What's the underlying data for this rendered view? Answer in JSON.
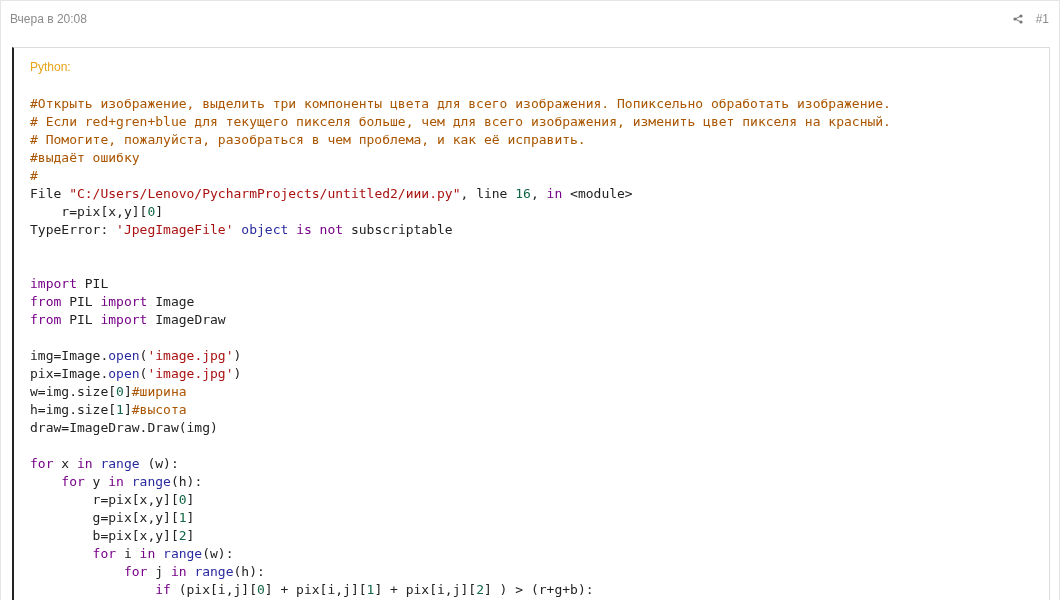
{
  "post": {
    "time": "Вчера в 20:08",
    "number": "#1"
  },
  "code_block": {
    "language": "Python:",
    "lines": [
      {
        "kind": "code",
        "tokens": [
          {
            "kind": "comment",
            "text": "#Открыть изображение, выделить три компоненты цвета для всего изображения. Попиксельно обработать изображение."
          }
        ]
      },
      {
        "kind": "code",
        "tokens": [
          {
            "kind": "comment",
            "text": "# Если red+gren+blue для текущего пикселя больше, чем для всего изображения, изменить цвет пикселя на красный."
          }
        ]
      },
      {
        "kind": "code",
        "tokens": [
          {
            "kind": "comment",
            "text": "# Помогите, пожалуйста, разобраться в чем проблема, и как её исправить."
          }
        ]
      },
      {
        "kind": "code",
        "tokens": [
          {
            "kind": "comment",
            "text": "#выдаёт ошибку"
          }
        ]
      },
      {
        "kind": "code",
        "tokens": [
          {
            "kind": "comment",
            "text": "#"
          }
        ]
      },
      {
        "kind": "code",
        "tokens": [
          {
            "kind": "plain",
            "text": "File "
          },
          {
            "kind": "string",
            "text": "\"C:/Users/Lenovo/PycharmProjects/untitled2/иии.py\""
          },
          {
            "kind": "plain",
            "text": ", line "
          },
          {
            "kind": "number",
            "text": "16"
          },
          {
            "kind": "plain",
            "text": ", "
          },
          {
            "kind": "keyword",
            "text": "in"
          },
          {
            "kind": "plain",
            "text": " <module>"
          }
        ]
      },
      {
        "kind": "code",
        "tokens": [
          {
            "kind": "plain",
            "text": "    r=pix[x,y]["
          },
          {
            "kind": "number",
            "text": "0"
          },
          {
            "kind": "plain",
            "text": "]"
          }
        ]
      },
      {
        "kind": "code",
        "tokens": [
          {
            "kind": "plain",
            "text": "TypeError: "
          },
          {
            "kind": "string",
            "text": "'JpegImageFile' "
          },
          {
            "kind": "builtin",
            "text": "object "
          },
          {
            "kind": "keyword",
            "text": "is "
          },
          {
            "kind": "keyword",
            "text": "not"
          },
          {
            "kind": "plain",
            "text": " subscriptable"
          }
        ]
      },
      {
        "kind": "blank"
      },
      {
        "kind": "blank"
      },
      {
        "kind": "code",
        "tokens": [
          {
            "kind": "keyword",
            "text": "import"
          },
          {
            "kind": "plain",
            "text": " PIL"
          }
        ]
      },
      {
        "kind": "code",
        "tokens": [
          {
            "kind": "keyword",
            "text": "from"
          },
          {
            "kind": "plain",
            "text": " PIL "
          },
          {
            "kind": "keyword",
            "text": "import"
          },
          {
            "kind": "plain",
            "text": " Image"
          }
        ]
      },
      {
        "kind": "code",
        "tokens": [
          {
            "kind": "keyword",
            "text": "from"
          },
          {
            "kind": "plain",
            "text": " PIL "
          },
          {
            "kind": "keyword",
            "text": "import"
          },
          {
            "kind": "plain",
            "text": " ImageDraw"
          }
        ]
      },
      {
        "kind": "blank"
      },
      {
        "kind": "code",
        "tokens": [
          {
            "kind": "plain",
            "text": "img=Image."
          },
          {
            "kind": "builtin",
            "text": "open"
          },
          {
            "kind": "plain",
            "text": "("
          },
          {
            "kind": "string",
            "text": "'image.jpg'"
          },
          {
            "kind": "plain",
            "text": ")"
          }
        ]
      },
      {
        "kind": "code",
        "tokens": [
          {
            "kind": "plain",
            "text": "pix=Image."
          },
          {
            "kind": "builtin",
            "text": "open"
          },
          {
            "kind": "plain",
            "text": "("
          },
          {
            "kind": "string",
            "text": "'image.jpg'"
          },
          {
            "kind": "plain",
            "text": ")"
          }
        ]
      },
      {
        "kind": "code",
        "tokens": [
          {
            "kind": "plain",
            "text": "w=img.size["
          },
          {
            "kind": "number",
            "text": "0"
          },
          {
            "kind": "plain",
            "text": "]"
          },
          {
            "kind": "comment",
            "text": "#ширина"
          }
        ]
      },
      {
        "kind": "code",
        "tokens": [
          {
            "kind": "plain",
            "text": "h=img.size["
          },
          {
            "kind": "number",
            "text": "1"
          },
          {
            "kind": "plain",
            "text": "]"
          },
          {
            "kind": "comment",
            "text": "#высота"
          }
        ]
      },
      {
        "kind": "code",
        "tokens": [
          {
            "kind": "plain",
            "text": "draw=ImageDraw.Draw(img)"
          }
        ]
      },
      {
        "kind": "blank"
      },
      {
        "kind": "code",
        "tokens": [
          {
            "kind": "keyword",
            "text": "for"
          },
          {
            "kind": "plain",
            "text": " x "
          },
          {
            "kind": "keyword",
            "text": "in "
          },
          {
            "kind": "builtin",
            "text": "range"
          },
          {
            "kind": "plain",
            "text": " (w):"
          }
        ]
      },
      {
        "kind": "code",
        "tokens": [
          {
            "kind": "keyword",
            "text": "    for"
          },
          {
            "kind": "plain",
            "text": " y "
          },
          {
            "kind": "keyword",
            "text": "in "
          },
          {
            "kind": "builtin",
            "text": "range"
          },
          {
            "kind": "plain",
            "text": "(h):"
          }
        ]
      },
      {
        "kind": "code",
        "tokens": [
          {
            "kind": "plain",
            "text": "        r=pix[x,y]["
          },
          {
            "kind": "number",
            "text": "0"
          },
          {
            "kind": "plain",
            "text": "]"
          }
        ]
      },
      {
        "kind": "code",
        "tokens": [
          {
            "kind": "plain",
            "text": "        g=pix[x,y]["
          },
          {
            "kind": "number",
            "text": "1"
          },
          {
            "kind": "plain",
            "text": "]"
          }
        ]
      },
      {
        "kind": "code",
        "tokens": [
          {
            "kind": "plain",
            "text": "        b=pix[x,y]["
          },
          {
            "kind": "number",
            "text": "2"
          },
          {
            "kind": "plain",
            "text": "]"
          }
        ]
      },
      {
        "kind": "code",
        "tokens": [
          {
            "kind": "keyword",
            "text": "        for"
          },
          {
            "kind": "plain",
            "text": " i "
          },
          {
            "kind": "keyword",
            "text": "in "
          },
          {
            "kind": "builtin",
            "text": "range"
          },
          {
            "kind": "plain",
            "text": "(w):"
          }
        ]
      },
      {
        "kind": "code",
        "tokens": [
          {
            "kind": "keyword",
            "text": "            for"
          },
          {
            "kind": "plain",
            "text": " j "
          },
          {
            "kind": "keyword",
            "text": "in "
          },
          {
            "kind": "builtin",
            "text": "range"
          },
          {
            "kind": "plain",
            "text": "(h):"
          }
        ]
      },
      {
        "kind": "code",
        "tokens": [
          {
            "kind": "keyword",
            "text": "                if"
          },
          {
            "kind": "plain",
            "text": " (pix[i,j]["
          },
          {
            "kind": "number",
            "text": "0"
          },
          {
            "kind": "plain",
            "text": "] + pix[i,j]["
          },
          {
            "kind": "number",
            "text": "1"
          },
          {
            "kind": "plain",
            "text": "] + pix[i,j]["
          },
          {
            "kind": "number",
            "text": "2"
          },
          {
            "kind": "plain",
            "text": "] ) > (r+g+b):"
          }
        ]
      }
    ]
  }
}
